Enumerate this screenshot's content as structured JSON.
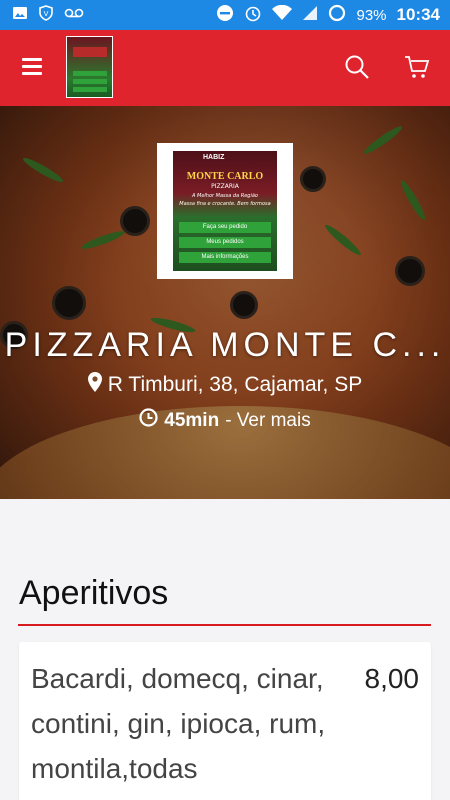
{
  "status_bar": {
    "battery": "93%",
    "time": "10:34",
    "icons": [
      "image-icon",
      "shield-icon",
      "voicemail-icon",
      "dnd-icon",
      "alarm-icon",
      "wifi-icon",
      "signal-icon",
      "battery-icon"
    ]
  },
  "app_bar": {
    "background": "#e0242e",
    "icons": [
      "menu-icon",
      "search-icon",
      "cart-icon"
    ]
  },
  "store": {
    "name": "PIZZARIA MONTE C...",
    "address": "R Timburi, 38, Cajamar, SP",
    "delivery_time": "45min",
    "more_label": "- Ver mais",
    "logo": {
      "brand": "HABIZ",
      "name": "MONTE CARLO",
      "subtitle": "PIZZARIA",
      "tagline": "A Melhor Massa da Região",
      "tagline2": "Massa fina e crocante. Bem formosa",
      "buttons": [
        "Faça seu pedido",
        "Meus pedidos",
        "Mais informações"
      ]
    }
  },
  "menu": {
    "section_title": "Aperitivos",
    "items": [
      {
        "name": "Bacardi, domecq, cinar, contini, gin, ipioca, rum, montila,todas",
        "price": "8,00"
      }
    ]
  }
}
